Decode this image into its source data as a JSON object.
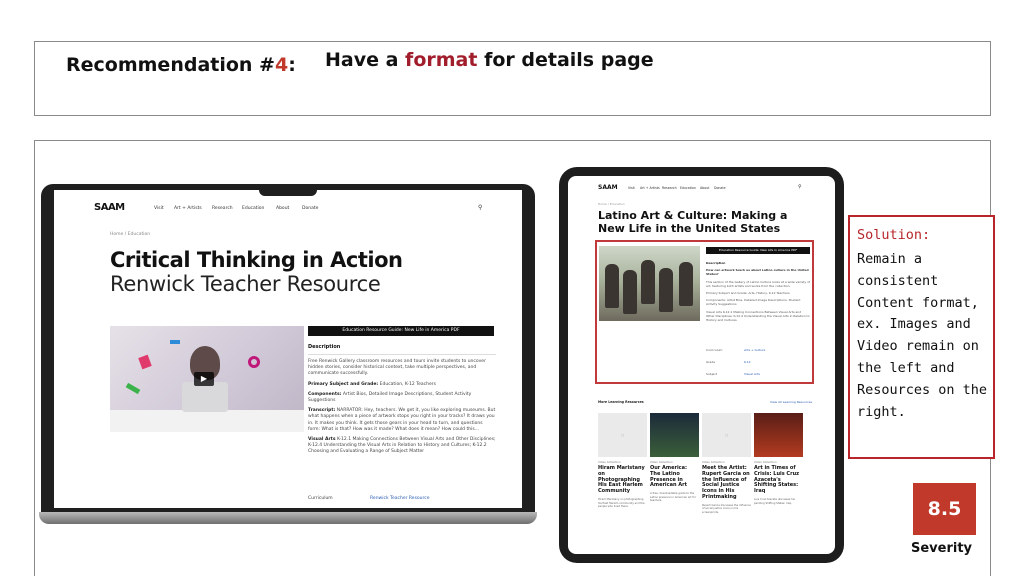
{
  "header": {
    "rec_prefix": "Recommendation #",
    "rec_number": "4",
    "rec_suffix": ":",
    "title_before": "Have a ",
    "title_highlight": "format",
    "title_after": " for details page"
  },
  "laptop_site": {
    "logo": "SAAM",
    "nav": [
      "Visit",
      "Art + Artists",
      "Research",
      "Education",
      "About",
      "Donate"
    ],
    "breadcrumb": "Home  /  Education",
    "title_line1": "Critical Thinking in Action",
    "title_line2": "Renwick Teacher Resource",
    "resource_banner": "Education Resource Guide: New Life in America PDF",
    "description_heading": "Description",
    "description_text": "Free Renwick Gallery classroom resources and tours invite students to uncover hidden stories, consider historical context, take multiple perspectives, and communicate successfully.",
    "subject_label": "Primary Subject and Grade:",
    "subject_value": "Education, K-12 Teachers",
    "components_label": "Components:",
    "components_value": "Artist Bios, Detailed Image Descriptions, Student Activity Suggestions",
    "transcript_label": "Transcript:",
    "transcript_value": "NARRATOR: Hey, teachers. We get it, you like exploring museums. But what happens when a piece of artwork stops you right in your tracks? It draws you in. It makes you think. It gets those gears in your head to turn, and questions form: What is that? How was it made? What does it mean? How could this...",
    "visual_arts_label": "Visual Arts",
    "visual_arts_value": "K-12.1 Making Connections Between Visual Arts and Other Disciplines; K-12.4 Understanding the Visual Arts in Relation to History and Cultures; K-12.2 Choosing and Evaluating a Range of Subject Matter",
    "curriculum_label": "Curriculum",
    "curriculum_link": "Renwick Teacher Resource"
  },
  "tablet_site": {
    "logo": "SAAM",
    "nav": [
      "Visit",
      "Art + Artists",
      "Research",
      "Education",
      "About",
      "Donate"
    ],
    "breadcrumb": "Home  /  Education",
    "title": "Latino Art & Culture: Making a New Life in the United States",
    "resource_banner": "Education Resource Guide: New Life in America PDF",
    "description_heading": "Description",
    "question": "How can artwork teach us about Latino culture in the United States?",
    "body": "This section of the Gallery of Latino Culture looks at a wide variety of art, featuring both artists and works from the collection.",
    "subject": "Primary Subject and Grade: Arts, History, K-12 Teachers",
    "components": "Components: Artist Bios, Detailed Image Descriptions, Student Activity Suggestions",
    "standards": "Visual Arts K-12.1 Making Connections Between Visual Arts and Other Disciplines; K-12.4 Understanding the Visual Arts in Relation to History and Cultures",
    "rows": [
      {
        "label": "Curriculum",
        "value": "Arts + Culture"
      },
      {
        "label": "Grade",
        "value": "K-12"
      },
      {
        "label": "Subject",
        "value": "Visual Arts"
      }
    ],
    "more_label": "More Learning Resources",
    "more_link": "View All Learning Resources",
    "cards": [
      {
        "tag": "Video Collection",
        "title": "Hiram Maristany on Photographing His East Harlem Community",
        "body": "Hiram Maristany on photographing his East Harlem community and the people who lived there."
      },
      {
        "tag": "Video Collection",
        "title": "Our America: The Latino Presence in American Art",
        "body": "A free, downloadable guide to the Latino presence in American art for teachers."
      },
      {
        "tag": "Video Collection",
        "title": "Meet the Artist: Rupert Garcia on the Influence of Social Justice Icons in His Printmaking",
        "body": "Rupert Garcia discusses the influence of social justice icons on his screenprints."
      },
      {
        "tag": "Video Collection",
        "title": "Art in Times of Crisis: Luis Cruz Azaceta's Shifting States: Iraq",
        "body": "Luis Cruz Azaceta discusses his painting Shifting States: Iraq."
      }
    ]
  },
  "solution": {
    "label": "Solution:",
    "text": "Remain a consistent Content format, ex. Images and Video remain on the left and Resources on the right."
  },
  "severity": {
    "score": "8.5",
    "label": "Severity"
  },
  "colors": {
    "accent_red": "#c0392b",
    "highlight_red": "#a11d2b",
    "link_blue": "#2a5db0"
  }
}
